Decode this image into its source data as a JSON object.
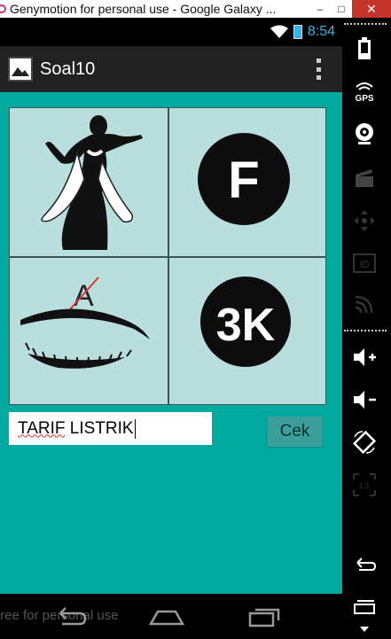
{
  "window": {
    "title": "Genymotion for personal use - Google Galaxy ...",
    "minimize": "–",
    "maximize": "□",
    "close": "✕"
  },
  "status_bar": {
    "time": "8:54",
    "icons": [
      "wifi-icon",
      "battery-icon"
    ]
  },
  "action_bar": {
    "title": "Soal10",
    "app_icon": "picture-icon",
    "overflow_icon": "overflow-menu-icon"
  },
  "puzzle": {
    "images": [
      {
        "name": "dancer-silhouette-image",
        "description_icon": "dancer"
      },
      {
        "name": "letter-f-circle-image",
        "letter": "F"
      },
      {
        "name": "eyelash-crossed-a-image",
        "letter": "A"
      },
      {
        "name": "3k-circle-image",
        "letter": "3K"
      }
    ]
  },
  "form": {
    "input_value_underlined": "TARIF",
    "input_value_rest": " LISTRIK",
    "button_label": "Cek"
  },
  "nav_bar": {
    "watermark": "free for personal use",
    "buttons": [
      "back-icon",
      "home-icon",
      "recent-apps-icon"
    ]
  },
  "sidebar": {
    "items": [
      "battery-icon",
      "gps-icon",
      "webcam-icon",
      "video-capture-icon",
      "dpad-icon",
      "device-id-icon",
      "cast-icon",
      "volume-up-icon",
      "volume-down-icon",
      "rotate-icon",
      "scale-icon",
      "back-icon",
      "menu-icon"
    ],
    "gps_label": "GPS",
    "id_label": "ID",
    "scale_label": "1:1"
  },
  "colors": {
    "teal_background": "#00a99d",
    "tile_background": "#b8dede",
    "button": "#3c9e9a",
    "accent_blue": "#33b5e5"
  }
}
